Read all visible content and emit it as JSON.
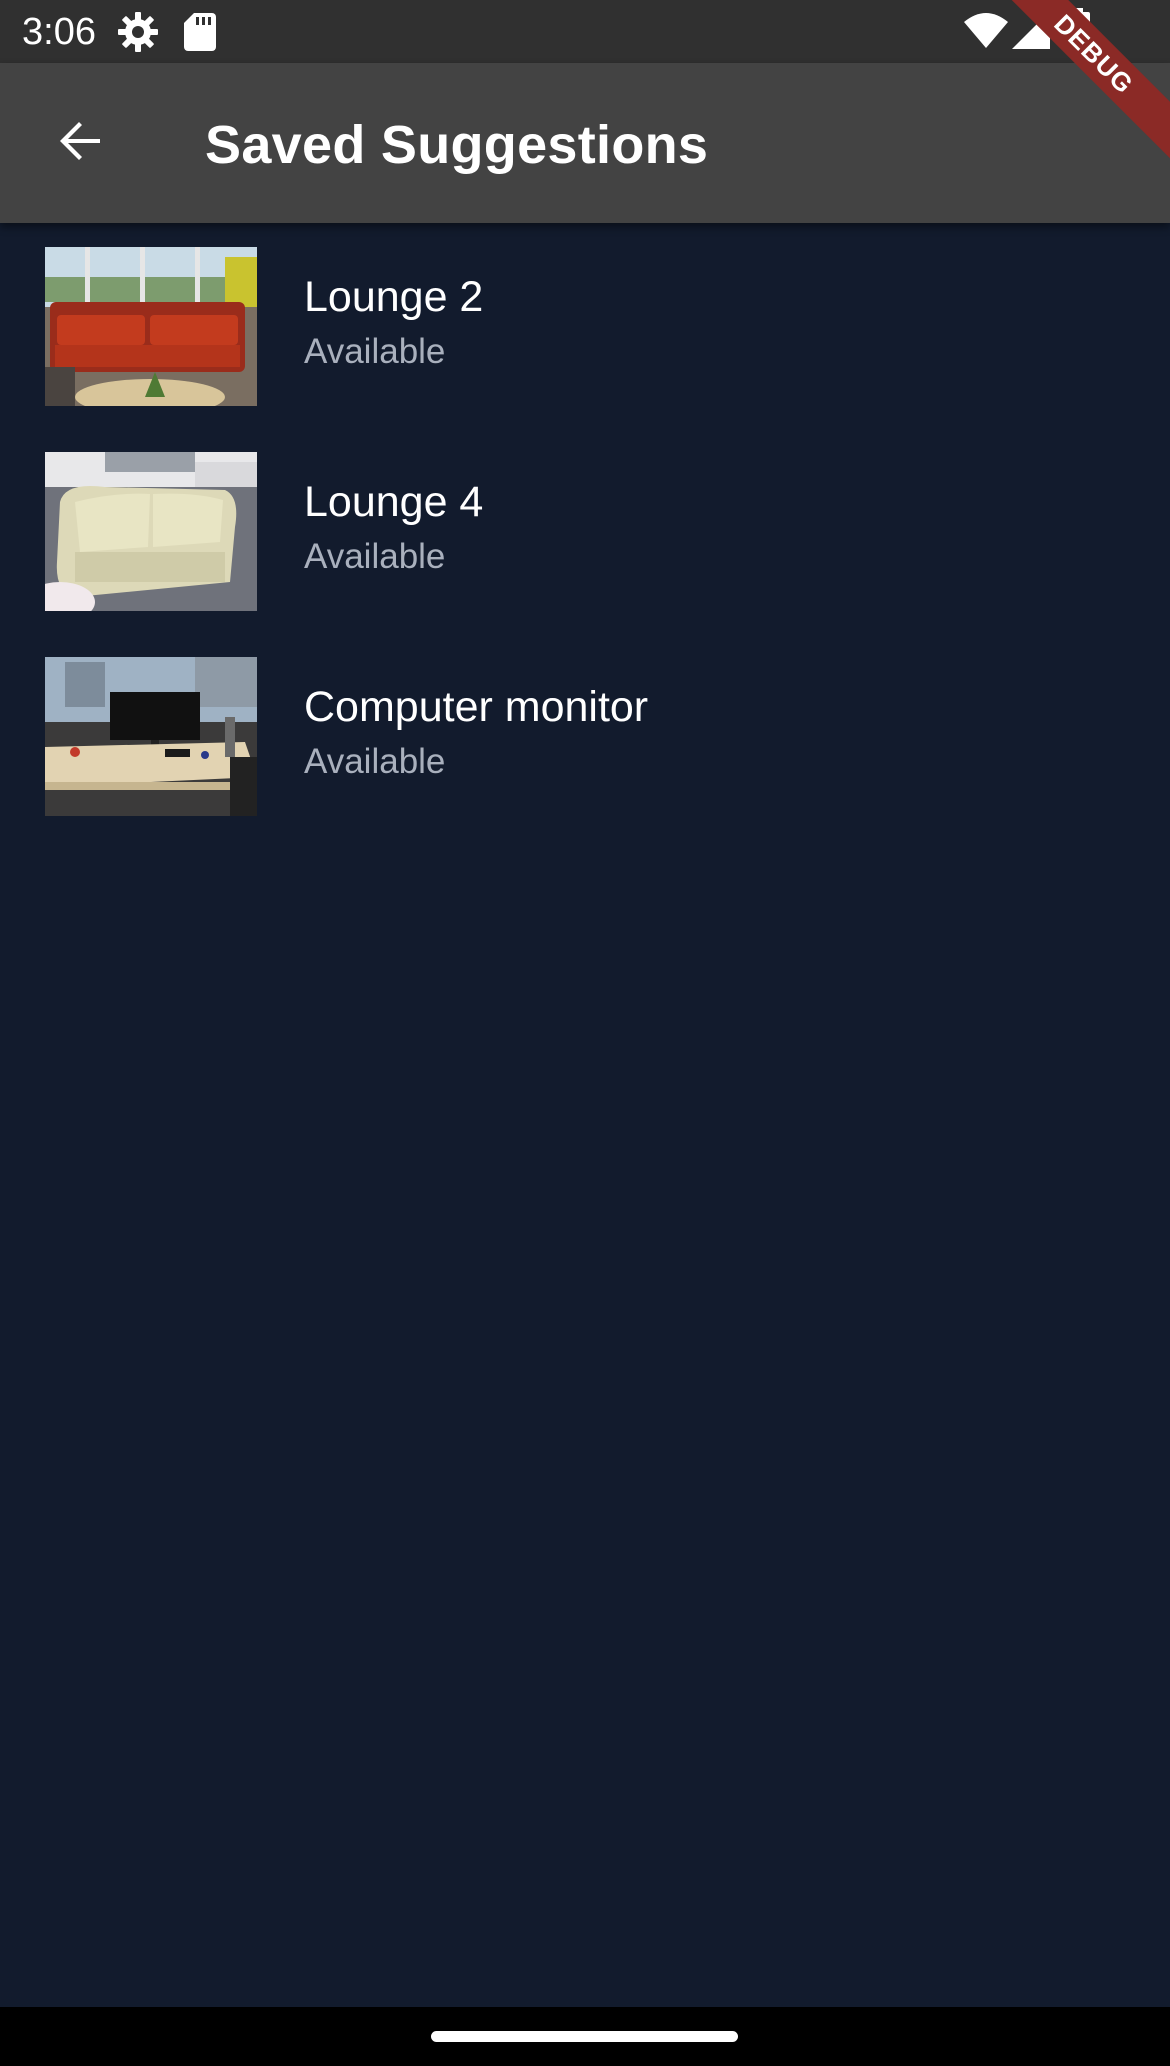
{
  "status_bar": {
    "time": "3:06",
    "icons": [
      "settings-gear-icon",
      "sd-card-icon",
      "wifi-icon",
      "cell-signal-icon",
      "battery-icon"
    ]
  },
  "app_bar": {
    "back_icon": "arrow-back-icon",
    "title": "Saved Suggestions"
  },
  "debug_banner": {
    "label": "DEBUG",
    "color": "#8b2a26"
  },
  "items": [
    {
      "title": "Lounge 2",
      "subtitle": "Available",
      "thumbnail": "orange-sofa-photo"
    },
    {
      "title": "Lounge 4",
      "subtitle": "Available",
      "thumbnail": "cream-sofa-photo"
    },
    {
      "title": "Computer monitor",
      "subtitle": "Available",
      "thumbnail": "desk-monitor-photo"
    }
  ],
  "colors": {
    "background": "#121b2d",
    "app_bar": "#434343",
    "status_bar": "#303030",
    "subtitle": "#a9b0bd"
  }
}
